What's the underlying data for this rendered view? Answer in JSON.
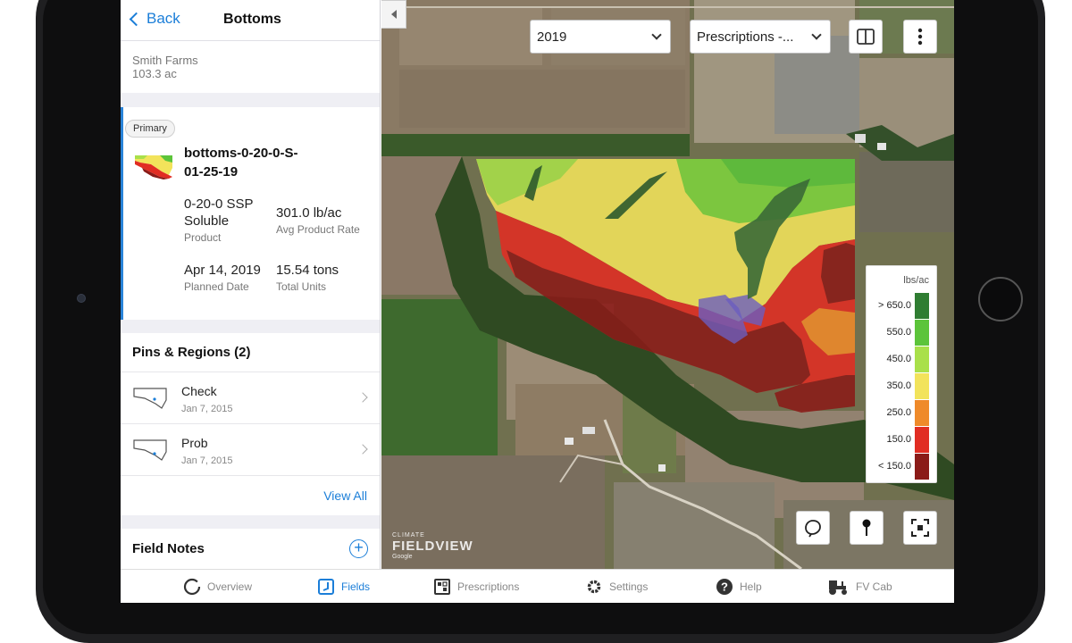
{
  "nav": {
    "back_label": "Back",
    "title": "Bottoms"
  },
  "farm": {
    "name": "Smith Farms",
    "area": "103.3 ac"
  },
  "prescription": {
    "badge": "Primary",
    "name": "bottoms-0-20-0-S-01-25-19",
    "product_value": "0-20-0 SSP Soluble",
    "product_label": "Product",
    "rate_value": "301.0 lb/ac",
    "rate_label": "Avg Product Rate",
    "date_value": "Apr 14, 2019",
    "date_label": "Planned Date",
    "units_value": "15.54 tons",
    "units_label": "Total Units"
  },
  "pins": {
    "title": "Pins & Regions (2)",
    "items": [
      {
        "title": "Check",
        "date": "Jan 7, 2015"
      },
      {
        "title": "Prob",
        "date": "Jan 7, 2015"
      }
    ],
    "view_all": "View All"
  },
  "notes": {
    "title": "Field Notes"
  },
  "map": {
    "year_select": "2019",
    "layer_select": "Prescriptions -...",
    "watermark_small": "CLIMATE",
    "watermark_brand": "FIELDVIEW",
    "watermark_google": "Google"
  },
  "legend": {
    "unit": "lbs/ac",
    "rows": [
      {
        "label": "> 650.0",
        "color": "#2f7d32"
      },
      {
        "label": "550.0",
        "color": "#5cc43a"
      },
      {
        "label": "450.0",
        "color": "#a9e04a"
      },
      {
        "label": "350.0",
        "color": "#f2e35b"
      },
      {
        "label": "250.0",
        "color": "#ef8a2a"
      },
      {
        "label": "150.0",
        "color": "#e12d23"
      },
      {
        "label": "< 150.0",
        "color": "#8b1b18"
      }
    ]
  },
  "tabs": [
    {
      "label": "Overview",
      "icon": "overview-circle-icon"
    },
    {
      "label": "Fields",
      "icon": "fields-icon"
    },
    {
      "label": "Prescriptions",
      "icon": "prescriptions-icon"
    },
    {
      "label": "Settings",
      "icon": "gear-icon"
    },
    {
      "label": "Help",
      "icon": "help-icon"
    },
    {
      "label": "FV Cab",
      "icon": "tractor-icon"
    }
  ],
  "colors": {
    "accent": "#1b7ed8",
    "primary_bar": "#2a83d8"
  }
}
